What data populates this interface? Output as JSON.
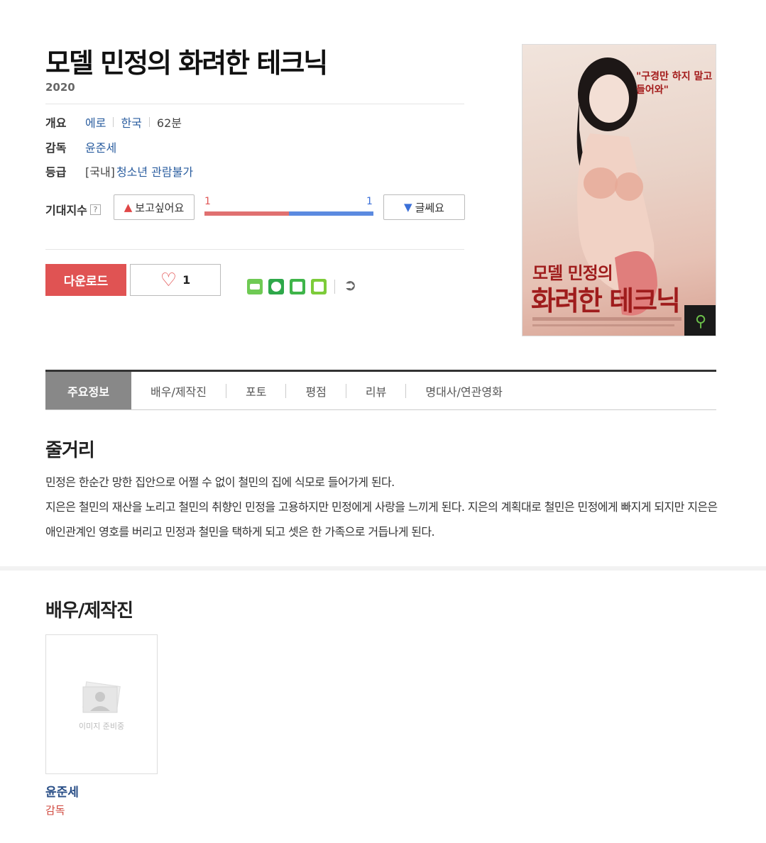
{
  "movie": {
    "title": "모델 민정의 화려한 테크닉",
    "year": "2020"
  },
  "info": {
    "summary_label": "개요",
    "genre": "에로",
    "country": "한국",
    "runtime": "62분",
    "director_label": "감독",
    "director": "윤준세",
    "rating_label": "등급",
    "rating_prefix": "[국내]",
    "rating": "청소년 관람불가"
  },
  "expect": {
    "label": "기대지수",
    "help": "?",
    "like_label": "보고싶어요",
    "dislike_label": "글쎄요",
    "like_count": "1",
    "dislike_count": "1",
    "like_ratio": 0.5
  },
  "actions": {
    "download_label": "다운로드",
    "heart_count": "1"
  },
  "poster": {
    "quote_line1": "\"구경만 하지 말고",
    "quote_line2": "들어와\"",
    "title_line1": "모델 민정의",
    "title_line2": "화려한 테크닉"
  },
  "tabs": [
    "주요정보",
    "배우/제작진",
    "포토",
    "평점",
    "리뷰",
    "명대사/연관영화"
  ],
  "plot": {
    "title": "줄거리",
    "line1": "민정은 한순간 망한 집안으로 어쩔 수 없이 철민의 집에 식모로 들어가게 된다.",
    "line2": " 지은은 철민의 재산을 노리고 철민의 취향인 민정을 고용하지만 민정에게 사랑을 느끼게 된다. 지은의 계획대로 철민은 민정에게 빠지게 되지만 지은은 애인관계인 영호를 버리고 민정과 철민을 택하게 되고 셋은 한 가족으로 거듭나게 된다."
  },
  "cast": {
    "title": "배우/제작진",
    "placeholder": "이미지 준비중",
    "name": "윤준세",
    "role": "감독"
  },
  "colors": {
    "accent_red": "#e05353",
    "link_blue": "#2a5d9f"
  }
}
